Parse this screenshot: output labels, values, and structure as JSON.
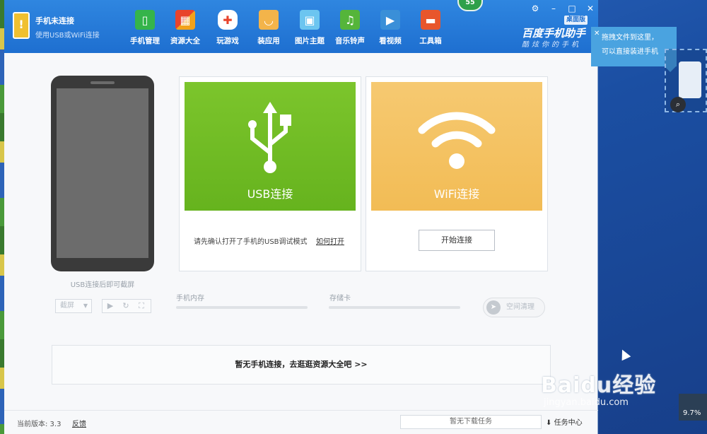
{
  "app": {
    "status_title": "手机未连接",
    "status_sub": "使用USB或WiFi连接",
    "brand_name": "百度手机助手",
    "brand_edition": "桌面版",
    "brand_slogan": "酷炫你的手机",
    "badge_count": "55"
  },
  "nav": {
    "items": [
      {
        "label": "手机管理",
        "icon": "phone-manage-icon",
        "color": "#35b44a"
      },
      {
        "label": "资源大全",
        "icon": "resources-icon",
        "color": "#f2a21b"
      },
      {
        "label": "玩游戏",
        "icon": "gamepad-icon",
        "color": "#ffffff"
      },
      {
        "label": "装应用",
        "icon": "shopping-bag-icon",
        "color": "#f3b44a"
      },
      {
        "label": "图片主题",
        "icon": "image-theme-icon",
        "color": "#6cc5f0"
      },
      {
        "label": "音乐铃声",
        "icon": "music-icon",
        "color": "#55b53a"
      },
      {
        "label": "看视频",
        "icon": "video-icon",
        "color": "#3a8fd8"
      },
      {
        "label": "工具箱",
        "icon": "toolbox-icon",
        "color": "#e8562c"
      }
    ]
  },
  "window_controls": {
    "settings": "⚙",
    "minimize": "–",
    "maximize": "□",
    "close": "✕"
  },
  "phone_panel": {
    "caption": "USB连接后即可截屏",
    "screenshot_label": "截屏"
  },
  "usb_card": {
    "label": "USB连接",
    "hint": "请先确认打开了手机的USB调试模式",
    "link": "如何打开"
  },
  "wifi_card": {
    "label": "WiFi连接",
    "button": "开始连接"
  },
  "storage": {
    "memory_label": "手机内存",
    "memory_used": 0,
    "sdcard_label": "存储卡",
    "sdcard_used": 0,
    "clean_label": "空间清理"
  },
  "banner": {
    "text": "暂无手机连接，去逛逛资源大全吧 >>"
  },
  "footer": {
    "version": "当前版本: 3.3",
    "feedback": "反馈",
    "downloads": "暂无下载任务",
    "task_center": "任务中心"
  },
  "tooltip": {
    "line1": "拖拽文件到这里，",
    "line2": "可以直接装进手机"
  },
  "system": {
    "progress": "9.7%"
  },
  "watermark": {
    "text": "Baidu经验",
    "url": "jingyan.baidu.com"
  },
  "colors": {
    "titlebar": "#1e6fd0",
    "usb_green": "#6fbe25",
    "wifi_orange": "#f4c160"
  }
}
